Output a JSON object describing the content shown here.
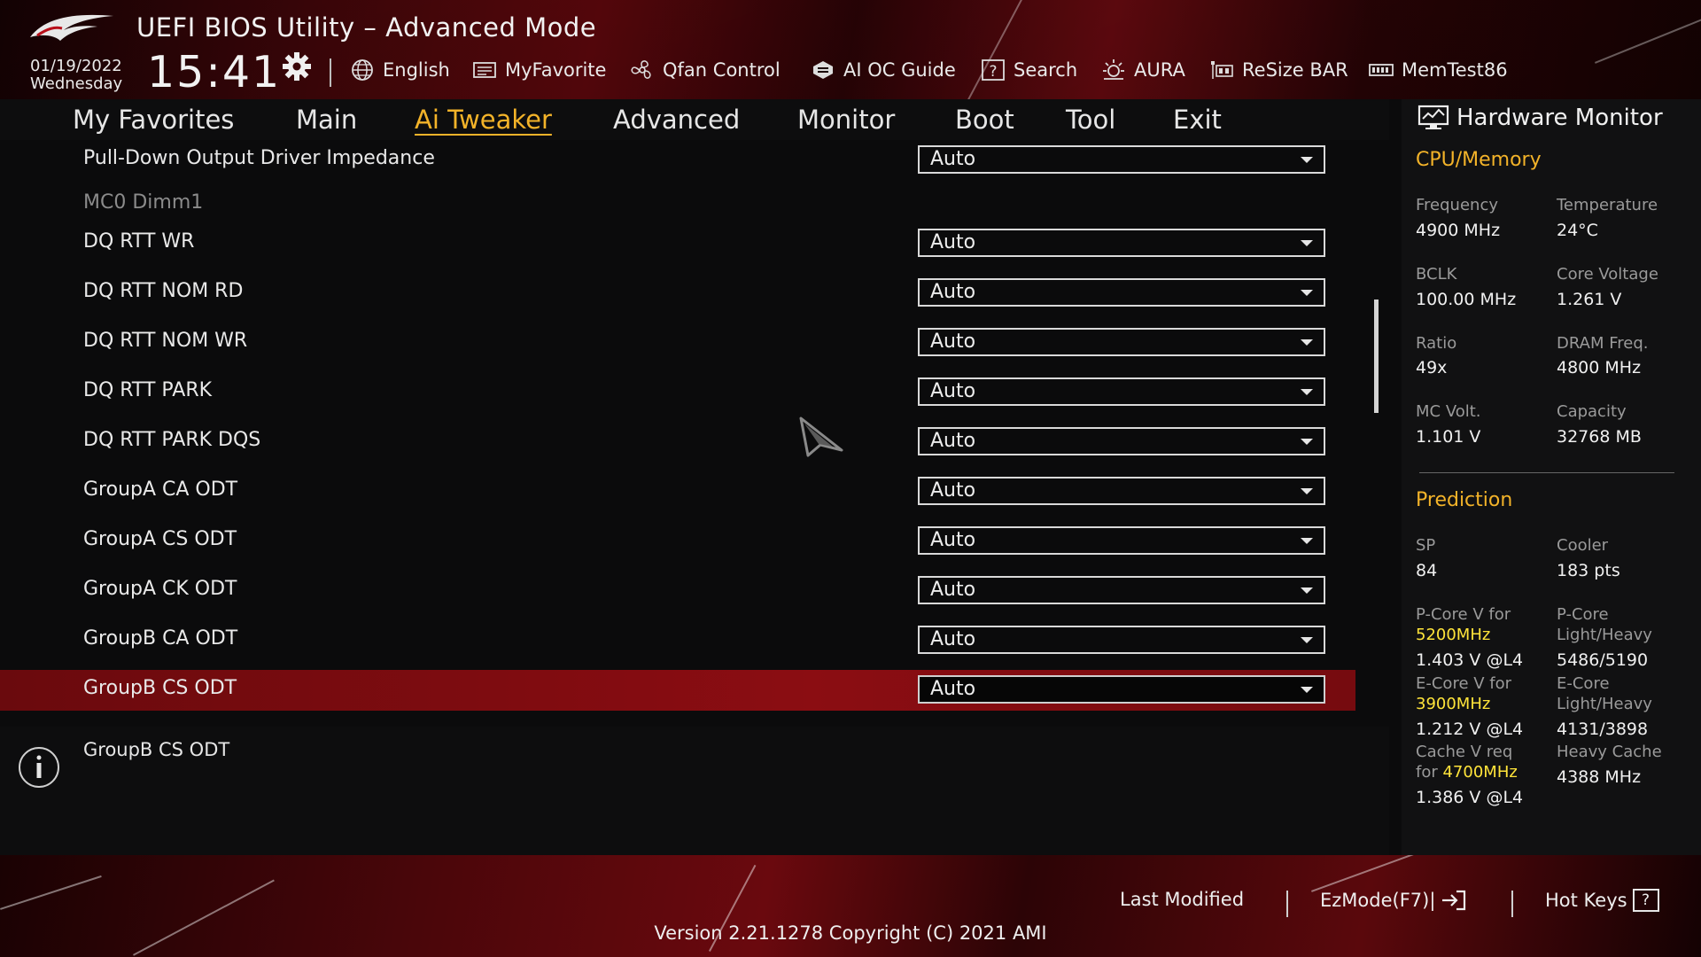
{
  "header": {
    "title": "UEFI BIOS Utility – Advanced Mode",
    "date": "01/19/2022",
    "weekday": "Wednesday",
    "time": "15:41",
    "tools": [
      {
        "label": "English",
        "icon": "globe-icon"
      },
      {
        "label": "MyFavorite",
        "icon": "favorite-icon"
      },
      {
        "label": "Qfan Control",
        "icon": "fan-icon"
      },
      {
        "label": "AI OC Guide",
        "icon": "ai-guide-icon"
      },
      {
        "label": "Search",
        "icon": "search-help-icon"
      },
      {
        "label": "AURA",
        "icon": "aura-icon"
      },
      {
        "label": "ReSize BAR",
        "icon": "resize-bar-icon"
      },
      {
        "label": "MemTest86",
        "icon": "memtest-icon"
      }
    ]
  },
  "tabs": [
    "My Favorites",
    "Main",
    "Ai Tweaker",
    "Advanced",
    "Monitor",
    "Boot",
    "Tool",
    "Exit"
  ],
  "active_tab": "Ai Tweaker",
  "settings": [
    {
      "label": "Pull-Down Output Driver Impedance",
      "value": "Auto"
    },
    {
      "label": "MC0 Dimm1",
      "section": true
    },
    {
      "label": "DQ RTT WR",
      "value": "Auto"
    },
    {
      "label": "DQ RTT NOM RD",
      "value": "Auto"
    },
    {
      "label": "DQ RTT NOM WR",
      "value": "Auto"
    },
    {
      "label": "DQ RTT PARK",
      "value": "Auto"
    },
    {
      "label": "DQ RTT PARK DQS",
      "value": "Auto"
    },
    {
      "label": "GroupA CA ODT",
      "value": "Auto"
    },
    {
      "label": "GroupA CS ODT",
      "value": "Auto"
    },
    {
      "label": "GroupA CK ODT",
      "value": "Auto"
    },
    {
      "label": "GroupB CA ODT",
      "value": "Auto"
    },
    {
      "label": "GroupB CS ODT",
      "value": "Auto",
      "selected": true
    }
  ],
  "help": {
    "text": "GroupB CS ODT"
  },
  "hardware_monitor": {
    "title": "Hardware Monitor",
    "cpu_memory": {
      "heading": "CPU/Memory",
      "frequency_label": "Frequency",
      "frequency_value": "4900 MHz",
      "temperature_label": "Temperature",
      "temperature_value": "24°C",
      "bclk_label": "BCLK",
      "bclk_value": "100.00 MHz",
      "core_voltage_label": "Core Voltage",
      "core_voltage_value": "1.261 V",
      "ratio_label": "Ratio",
      "ratio_value": "49x",
      "dram_freq_label": "DRAM Freq.",
      "dram_freq_value": "4800 MHz",
      "mc_volt_label": "MC Volt.",
      "mc_volt_value": "1.101 V",
      "capacity_label": "Capacity",
      "capacity_value": "32768 MB"
    },
    "prediction": {
      "heading": "Prediction",
      "sp_label": "SP",
      "sp_value": "84",
      "cooler_label": "Cooler",
      "cooler_value": "183 pts",
      "pcore_v_label": "P-Core V for",
      "pcore_v_freq": "5200MHz",
      "pcore_v_value": "1.403 V @L4",
      "pcore_lh_label_1": "P-Core",
      "pcore_lh_label_2": "Light/Heavy",
      "pcore_lh_value": "5486/5190",
      "ecore_v_label": "E-Core V for",
      "ecore_v_freq": "3900MHz",
      "ecore_v_value": "1.212 V @L4",
      "ecore_lh_label_1": "E-Core",
      "ecore_lh_label_2": "Light/Heavy",
      "ecore_lh_value": "4131/3898",
      "cache_v_label_1": "Cache V req",
      "cache_v_label_2": "for",
      "cache_v_freq": "4700MHz",
      "cache_v_value": "1.386 V @L4",
      "heavy_cache_label": "Heavy Cache",
      "heavy_cache_value": "4388 MHz"
    }
  },
  "footer": {
    "last_modified": "Last Modified",
    "ezmode": "EzMode(F7)|",
    "hotkeys": "Hot Keys",
    "hotkeys_key": "?",
    "version": "Version 2.21.1278 Copyright (C) 2021 AMI"
  },
  "colors": {
    "accent": "#f3b329",
    "highlight_red": "#8b0d12",
    "freq_yellow": "#ffe43a"
  }
}
